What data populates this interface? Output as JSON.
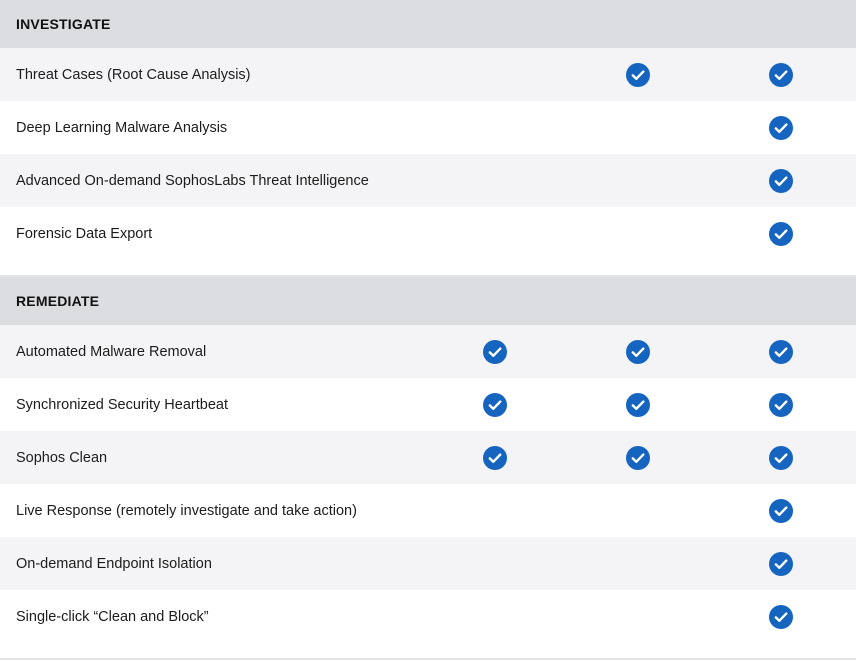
{
  "colors": {
    "header_bg": "#dcdde0",
    "row_alt_bg": "#f4f4f6",
    "check_fill": "#1565c0"
  },
  "icon": "check-circle-icon",
  "sections": [
    {
      "title": "INVESTIGATE",
      "rows": [
        {
          "label": "Threat Cases (Root Cause Analysis)",
          "checks": [
            false,
            true,
            true
          ]
        },
        {
          "label": "Deep Learning Malware Analysis",
          "checks": [
            false,
            false,
            true
          ]
        },
        {
          "label": "Advanced On-demand SophosLabs Threat Intelligence",
          "checks": [
            false,
            false,
            true
          ]
        },
        {
          "label": "Forensic Data Export",
          "checks": [
            false,
            false,
            true
          ]
        }
      ]
    },
    {
      "title": "REMEDIATE",
      "rows": [
        {
          "label": "Automated Malware Removal",
          "checks": [
            true,
            true,
            true
          ]
        },
        {
          "label": "Synchronized Security Heartbeat",
          "checks": [
            true,
            true,
            true
          ]
        },
        {
          "label": "Sophos Clean",
          "checks": [
            true,
            true,
            true
          ]
        },
        {
          "label": "Live Response (remotely investigate and take action)",
          "checks": [
            false,
            false,
            true
          ]
        },
        {
          "label": "On-demand Endpoint Isolation",
          "checks": [
            false,
            false,
            true
          ]
        },
        {
          "label": "Single-click “Clean and Block”",
          "checks": [
            false,
            false,
            true
          ]
        }
      ]
    }
  ]
}
